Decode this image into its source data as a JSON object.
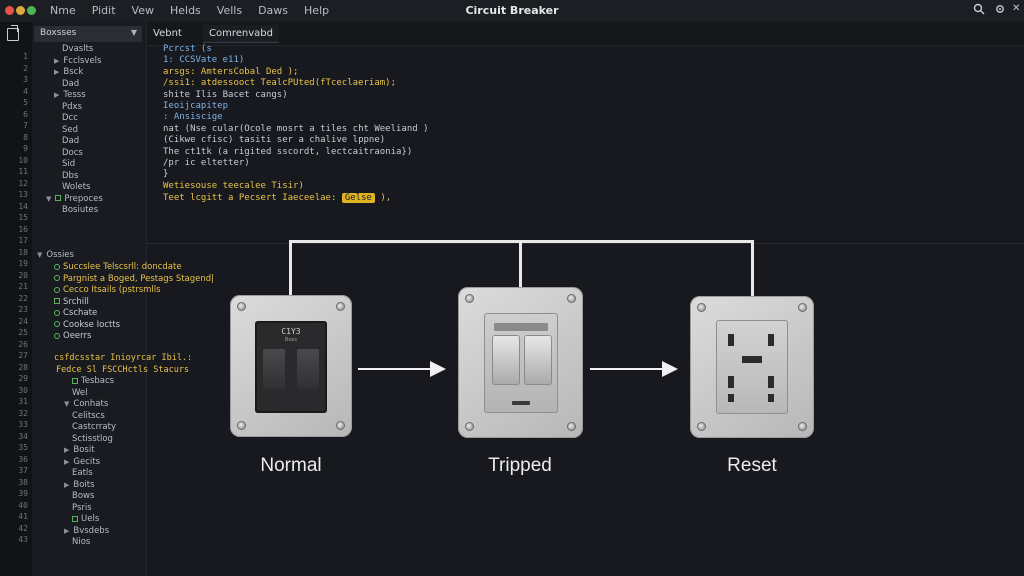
{
  "window": {
    "title": "Circuit Breaker",
    "menu": [
      "Nme",
      "Pidit",
      "Vew",
      "Helds",
      "Vells",
      "Daws",
      "Help"
    ],
    "traffic_lights": [
      "#e5534b",
      "#e0a93b",
      "#4cb84f"
    ]
  },
  "sidebar": {
    "dropdown": "Boxsses",
    "line_numbers": [
      "1",
      "2",
      "3",
      "4",
      "5",
      "6",
      "7",
      "8",
      "9",
      "10",
      "11",
      "12",
      "13",
      "14",
      "15",
      "16",
      "17",
      "18",
      "19",
      "20",
      "21",
      "22",
      "23",
      "24",
      "25",
      "26",
      "27",
      "28",
      "29",
      "30",
      "31",
      "32",
      "33",
      "34",
      "35",
      "36",
      "37",
      "38",
      "39",
      "40",
      "41",
      "42",
      "43"
    ],
    "tree_top": [
      {
        "label": "Dvaslts",
        "caret": ""
      },
      {
        "label": "Fcclsvels",
        "caret": "▶"
      },
      {
        "label": "Bsck",
        "caret": "▶"
      },
      {
        "label": "Dad",
        "caret": ""
      },
      {
        "label": "Tesss",
        "caret": "▶"
      },
      {
        "label": "Pdxs",
        "caret": ""
      },
      {
        "label": "Dcc",
        "caret": ""
      },
      {
        "label": "Sed",
        "caret": ""
      },
      {
        "label": "Dad",
        "caret": ""
      },
      {
        "label": "Docs",
        "caret": ""
      },
      {
        "label": "Sid",
        "caret": ""
      },
      {
        "label": "Dbs",
        "caret": ""
      },
      {
        "label": "Wolets",
        "caret": ""
      },
      {
        "label": "Prepoces",
        "caret": "▼"
      },
      {
        "label": "Bosiutes",
        "caret": ""
      }
    ],
    "section_header": "Ossies",
    "green_items": [
      {
        "text": "Succslee Telscsrll: doncdate",
        "color": "#e8c24a"
      },
      {
        "text": "Pargnist a Boged, Pestags Stagend|",
        "color": "#e8c24a"
      },
      {
        "text": "Cecco Itsails (pstrsmlls",
        "color": "#e8c24a"
      },
      {
        "text": "Srchill",
        "color": "#c9ccd2"
      },
      {
        "text": "Cschate",
        "color": "#c9ccd2"
      },
      {
        "text": "Cookse Ioctts",
        "color": "#c9ccd2"
      },
      {
        "text": "Oeerrs",
        "color": "#c9ccd2"
      }
    ],
    "mid_lines": [
      {
        "text": "csfdcsstar Inioyrcar Ibil.:",
        "color": "#e8c24a"
      },
      {
        "text": "Fedce Sl  FSCCHctls Stacurs",
        "color": "#e8c24a"
      }
    ],
    "tree_bottom": [
      {
        "label": "Tesbacs",
        "caret": ""
      },
      {
        "label": "Wel",
        "caret": ""
      },
      {
        "label": "Conhats",
        "caret": "▼"
      },
      {
        "label": "Celitscs",
        "caret": ""
      },
      {
        "label": "Castcrraty",
        "caret": ""
      },
      {
        "label": "Sctisstlog",
        "caret": ""
      },
      {
        "label": "Bosit",
        "caret": "▶"
      },
      {
        "label": "Gecits",
        "caret": "▶"
      },
      {
        "label": "Eatls",
        "caret": ""
      },
      {
        "label": "Boits",
        "caret": "▶"
      },
      {
        "label": "Bows",
        "caret": ""
      },
      {
        "label": "Psris",
        "caret": ""
      },
      {
        "label": "Uels",
        "caret": ""
      },
      {
        "label": "Bvsdebs",
        "caret": "▶"
      },
      {
        "label": "Nios",
        "caret": ""
      }
    ]
  },
  "tabs": [
    {
      "label": "Vebnt",
      "active": false
    },
    {
      "label": "Comrenvabd",
      "active": true
    }
  ],
  "editor": {
    "lines": [
      {
        "text": "Pcrcst  (s",
        "color": "#7fb2e8"
      },
      {
        "text": "1:  CCSVate  e11)",
        "color": "#7fb2e8"
      },
      {
        "text": "arsgs:  AmtersCobal  Ded );",
        "color": "#e8c24a"
      },
      {
        "text": "/ssi1: atdessooct  TealcPUted(fTceclaeriam);",
        "color": "#e8c24a"
      },
      {
        "text": "shite Ilis  Bacet  cangs)",
        "color": "#c9ccd2"
      },
      {
        "text": "Ieoijcapitep",
        "color": "#7fb2e8"
      },
      {
        "text": ":  Ansiscige",
        "color": "#7fb2e8"
      },
      {
        "text": "nat  (Nse  cular(Ocole  mosrt  a  tiles  cht  Weeliand )",
        "color": "#c9ccd2"
      },
      {
        "text": "(Cikwe  cfisc)  tasiti  ser  a  chalive  lppne)",
        "color": "#c9ccd2"
      },
      {
        "text": "The  ct1tk  (a  rigited  sscordt,  lectcaitraonia})",
        "color": "#c9ccd2"
      },
      {
        "text": "/pr  ic  eltetter)",
        "color": "#c9ccd2"
      },
      {
        "text": "}",
        "color": "#c9ccd2"
      },
      {
        "text": "Wetiesouse  teecalee  Tisir)",
        "color": "#e8c24a"
      }
    ],
    "last_line_prefix": "Teet  lcgitt  a  Pecsert  Iaeceelae:",
    "last_line_highlight": "Gelse",
    "last_line_suffix": "),"
  },
  "diagram": {
    "states": [
      {
        "label": "Normal",
        "badge": "C1Y3",
        "subbadge": "Boes"
      },
      {
        "label": "Tripped"
      },
      {
        "label": "Reset"
      }
    ]
  }
}
